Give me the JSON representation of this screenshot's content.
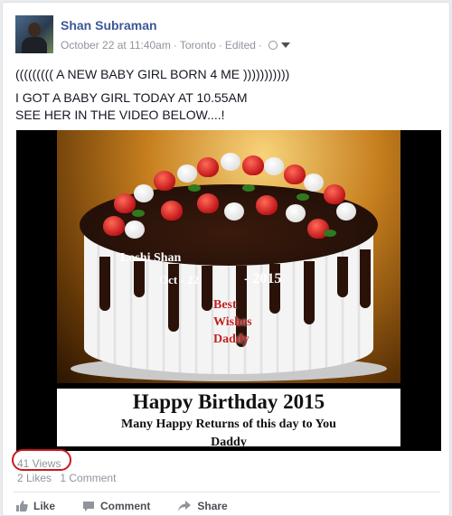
{
  "post": {
    "author": "Shan Subraman",
    "timestamp": "October 22 at 11:40am",
    "location": "Toronto",
    "edited": "Edited",
    "text_line1": "((((((((( A NEW BABY GIRL BORN 4 ME )))))))))))",
    "text_line2": "I GOT A BABY GIRL TODAY AT 10.55AM",
    "text_line3": "SEE HER IN THE VIDEO BELOW....!"
  },
  "video": {
    "cake_name": "Loshi Shan",
    "cake_date_left": "Oct - 22",
    "cake_date_right": "- 2015",
    "wish_line1": "Best",
    "wish_line2": "Wishes",
    "wish_line3": "Daddy",
    "banner_title": "Happy Birthday 2015",
    "banner_line1": "Many Happy Returns of this day to You",
    "banner_line2": "Daddy"
  },
  "stats": {
    "views": "41 Views",
    "likes": "2 Likes",
    "comments": "1 Comment"
  },
  "actions": {
    "like": "Like",
    "comment": "Comment",
    "share": "Share"
  },
  "icons": {
    "privacy": "globe-icon",
    "menu": "chevron-down-icon",
    "like": "thumbs-up-icon",
    "comment": "speech-bubble-icon",
    "share": "share-arrow-icon"
  },
  "colors": {
    "author_link": "#3b5998",
    "views_highlight": "#c81a1a"
  }
}
